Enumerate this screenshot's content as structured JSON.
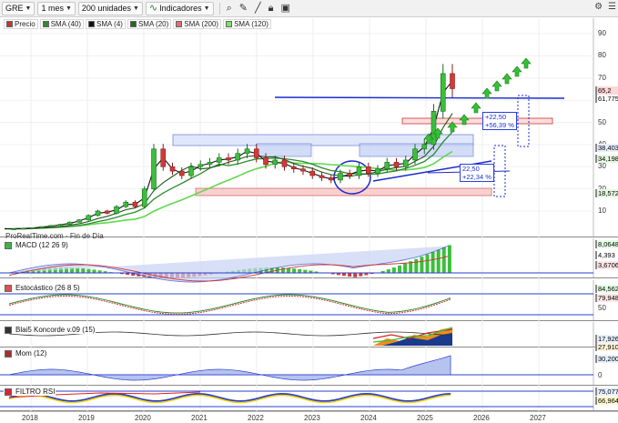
{
  "toolbar": {
    "ticker": "GRE",
    "period": "1 mes",
    "units": "200 unidades",
    "indicators": "Indicadores"
  },
  "legend": [
    {
      "label": "Precio",
      "color": "#c0392b"
    },
    {
      "label": "SMA (40)",
      "color": "#2e8b2e"
    },
    {
      "label": "SMA (4)",
      "color": "#111111"
    },
    {
      "label": "SMA (20)",
      "color": "#1f6a1f"
    },
    {
      "label": "SMA (200)",
      "color": "#e07070"
    },
    {
      "label": "SMA (120)",
      "color": "#7ee06e"
    }
  ],
  "price_axis": [
    "90",
    "80",
    "70",
    "60",
    "50",
    "40",
    "30",
    "20",
    "10"
  ],
  "price_tags": [
    {
      "text": "65,2",
      "bg": "#ffd7d7"
    },
    {
      "text": "61,775",
      "bg": "#ffffff"
    },
    {
      "text": "38,403",
      "bg": "#e8eefc"
    },
    {
      "text": "34,198",
      "bg": "#e6f7e0"
    },
    {
      "text": "18,572",
      "bg": "#e6f7e0"
    }
  ],
  "annotations": {
    "upper_box": "+22,50\n+56,39 %",
    "lower_box": "22,50\n+22,34 %"
  },
  "watermark": "ProRealTime.com - Fin de Día",
  "panels": {
    "macd": {
      "label": "MACD (12 26 9)",
      "values": [
        "8,0648",
        "4,393",
        "3,6706"
      ]
    },
    "stoch": {
      "label": "Estocástico (26 8 5)",
      "values": [
        "84,562",
        "79,948"
      ],
      "axis": "50"
    },
    "koncorde": {
      "label": "Blai5 Koncorde v.09 (15)",
      "values": [
        "17,926",
        "27,910"
      ]
    },
    "mom": {
      "label": "Mom (12)",
      "values": [
        "30,200"
      ],
      "axis": "0"
    },
    "rsi": {
      "label": "FILTRO RSI",
      "values": [
        "75,077",
        "66,964"
      ]
    }
  },
  "years": [
    "2018",
    "2019",
    "2020",
    "2021",
    "2022",
    "2023",
    "2024",
    "2025",
    "2026",
    "2027"
  ],
  "chart_data": {
    "type": "line",
    "title": "",
    "series": [
      {
        "name": "Precio",
        "values": [
          2,
          2,
          2.2,
          2.5,
          3,
          3.5,
          4,
          5,
          6,
          8,
          10,
          9,
          12,
          14,
          12,
          20,
          38,
          30,
          28,
          26,
          30,
          31,
          32,
          34,
          33,
          36,
          38,
          34,
          31,
          33,
          30,
          29,
          28,
          26,
          25,
          24,
          27,
          26,
          30,
          27,
          29,
          32,
          30,
          33,
          38,
          40,
          55,
          72,
          65.2
        ]
      }
    ],
    "ylim": [
      0,
      95
    ],
    "date_range": [
      "2018",
      "2025"
    ]
  }
}
